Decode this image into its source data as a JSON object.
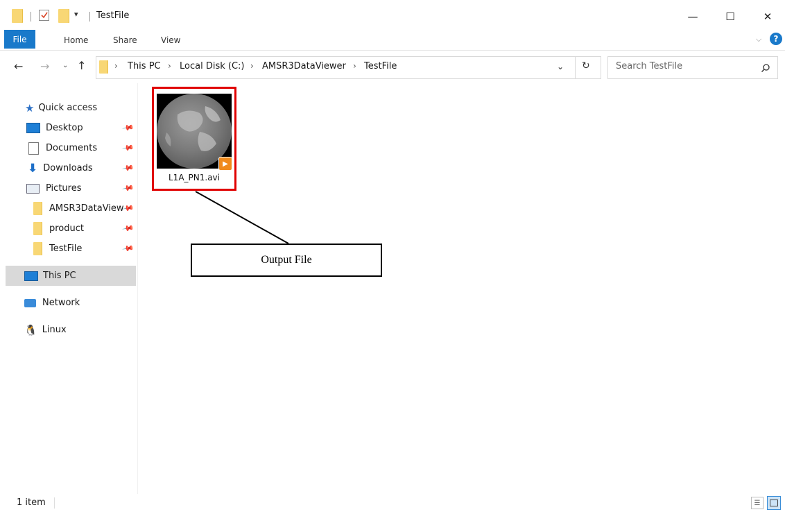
{
  "window": {
    "title": "TestFile",
    "controls": {
      "minimize": "—",
      "maximize": "☐",
      "close": "✕"
    }
  },
  "ribbon": {
    "tabs": [
      "File",
      "Home",
      "Share",
      "View"
    ],
    "help": "?"
  },
  "address": {
    "breadcrumb": [
      "This PC",
      "Local Disk (C:)",
      "AMSR3DataViewer",
      "TestFile"
    ],
    "search_placeholder": "Search TestFile"
  },
  "sidebar": {
    "quick_access": "Quick access",
    "pinned": [
      "Desktop",
      "Documents",
      "Downloads",
      "Pictures",
      "AMSR3DataView",
      "product",
      "TestFile"
    ],
    "this_pc": "This PC",
    "network": "Network",
    "linux": "Linux"
  },
  "content": {
    "file_name": "L1A_PN1.avi"
  },
  "annotation": {
    "label": "Output File"
  },
  "status": {
    "item_count": "1 item"
  },
  "colors": {
    "accent": "#1979ca",
    "highlight": "#e00000",
    "folder": "#f8d775"
  }
}
